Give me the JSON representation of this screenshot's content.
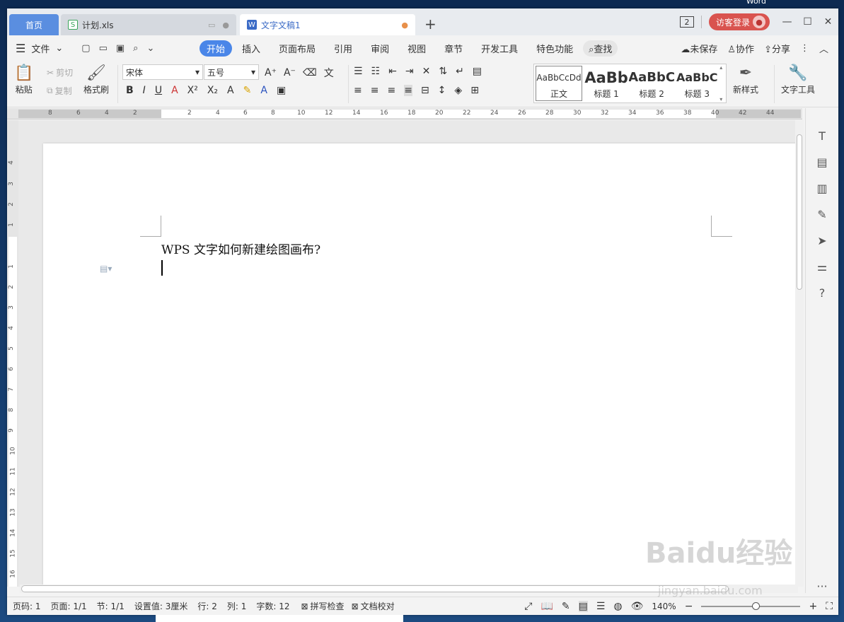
{
  "desktop": {
    "label": "Word"
  },
  "tabs": {
    "home": "首页",
    "xls": "计划.xls",
    "doc": "文字文稿1",
    "new": "+"
  },
  "titlebar": {
    "badge": "2",
    "login": "访客登录"
  },
  "menubar": {
    "file": "文件",
    "items": [
      "开始",
      "插入",
      "页面布局",
      "引用",
      "审阅",
      "视图",
      "章节",
      "开发工具",
      "特色功能"
    ],
    "search": "查找",
    "unsaved": "未保存",
    "collab": "协作",
    "share": "分享"
  },
  "ribbon": {
    "paste": "粘贴",
    "cut": "剪切",
    "copy": "复制",
    "format_painter": "格式刷",
    "font": "宋体",
    "size": "五号",
    "styles": [
      {
        "sample": "AaBbCcDd",
        "name": "正文"
      },
      {
        "sample": "AaBb",
        "name": "标题 1"
      },
      {
        "sample": "AaBbC",
        "name": "标题 2"
      },
      {
        "sample": "AaBbC",
        "name": "标题 3"
      }
    ],
    "new_style": "新样式",
    "text_tools": "文字工具"
  },
  "document": {
    "text": "WPS 文字如何新建绘图画布?"
  },
  "status": {
    "page_num": "页码: 1",
    "pages": "页面: 1/1",
    "section": "节: 1/1",
    "setting": "设置值: 3厘米",
    "row": "行: 2",
    "col": "列: 1",
    "words": "字数: 12",
    "spell": "拼写检查",
    "proof": "文档校对",
    "zoom": "140%"
  },
  "watermark": {
    "brand": "Baidu经验",
    "url": "jingyan.baidu.com"
  }
}
